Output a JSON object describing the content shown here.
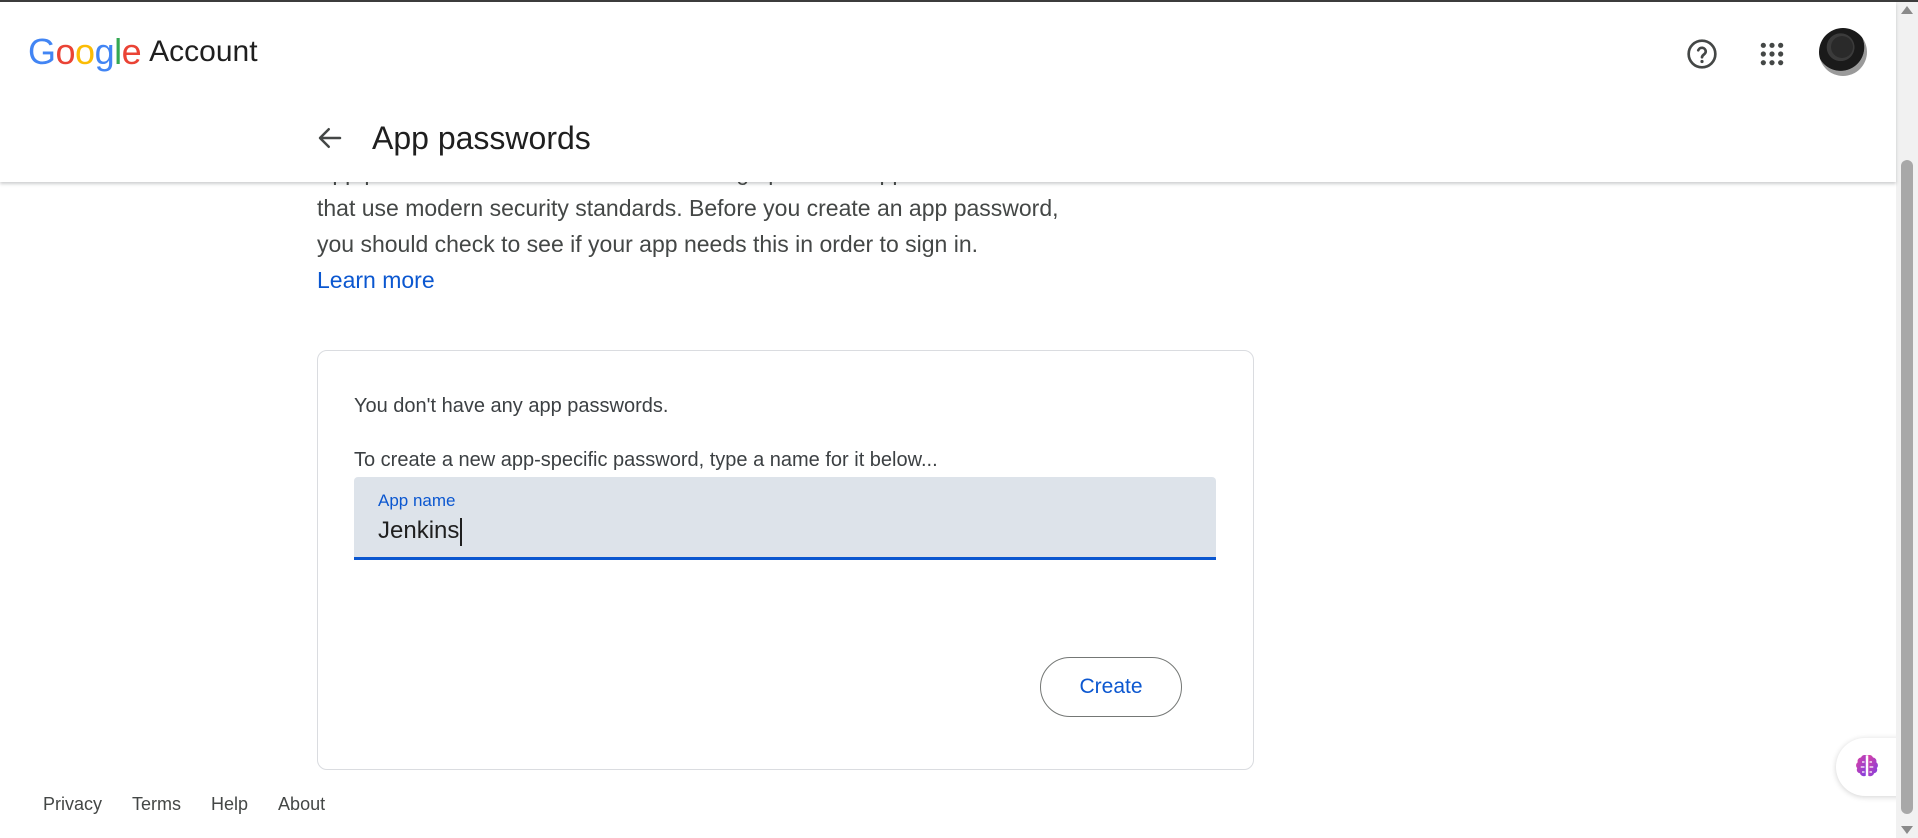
{
  "header": {
    "logo_google": [
      "G",
      "o",
      "o",
      "g",
      "l",
      "e"
    ],
    "logo_account": "Account",
    "help_icon": "help-circle-icon",
    "apps_icon": "apps-grid-icon",
    "avatar": "avatar"
  },
  "page": {
    "title": "App passwords",
    "description_cut": "App passwords are less secure than using up-to-date apps and services",
    "description_line2": "that use modern security standards. Before you create an app password,",
    "description_line3": "you should check to see if your app needs this in order to sign in.",
    "learn_more": "Learn more"
  },
  "card": {
    "empty_message": "You don't have any app passwords.",
    "instruction": "To create a new app-specific password, type a name for it below...",
    "field_label": "App name",
    "field_value": "Jenkins",
    "create_label": "Create"
  },
  "footer": {
    "links": [
      "Privacy",
      "Terms",
      "Help",
      "About"
    ]
  },
  "colors": {
    "accent": "#0b57d0",
    "field_bg": "#dde3ea",
    "google_blue": "#4285F4",
    "google_red": "#EA4335",
    "google_yellow": "#FBBC05",
    "google_green": "#34A853"
  }
}
